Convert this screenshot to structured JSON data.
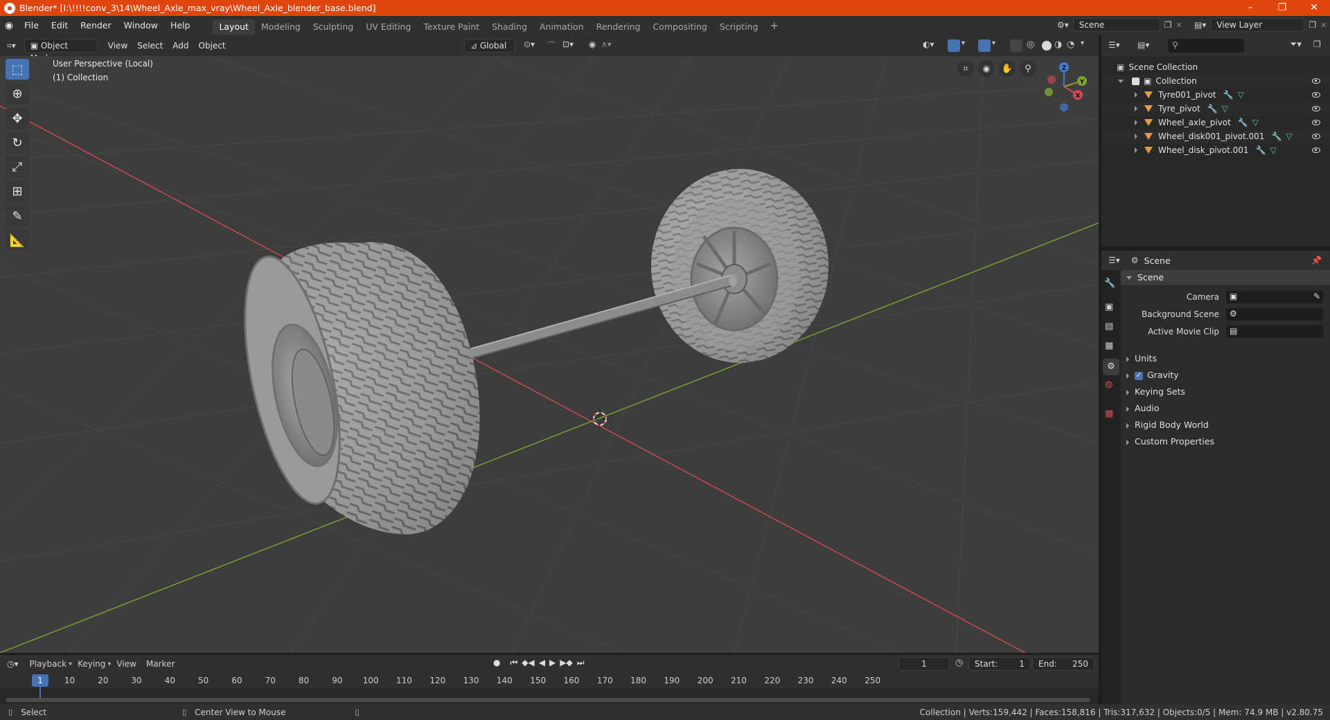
{
  "window": {
    "title": "Blender* [I:\\!!!!conv_3\\14\\Wheel_Axle_max_vray\\Wheel_Axle_blender_base.blend]",
    "controls": [
      "–",
      "❐",
      "✕"
    ]
  },
  "menu": [
    "File",
    "Edit",
    "Render",
    "Window",
    "Help"
  ],
  "workspaces": [
    "Layout",
    "Modeling",
    "Sculpting",
    "UV Editing",
    "Texture Paint",
    "Shading",
    "Animation",
    "Rendering",
    "Compositing",
    "Scripting"
  ],
  "active_workspace": "Layout",
  "scene_selector": "Scene",
  "view_layer_selector": "View Layer",
  "viewport_header": {
    "mode": "Object Mode",
    "menus": [
      "View",
      "Select",
      "Add",
      "Object"
    ],
    "orientation": "Global"
  },
  "viewport": {
    "perspective": "User Perspective (Local)",
    "collection": "(1) Collection",
    "gizmo_axes": [
      "Z",
      "Y",
      "X"
    ]
  },
  "outliner": {
    "root": "Scene Collection",
    "collection": "Collection",
    "items": [
      "Tyre001_pivot",
      "Tyre_pivot",
      "Wheel_axle_pivot",
      "Wheel_disk001_pivot.001",
      "Wheel_disk_pivot.001"
    ]
  },
  "properties": {
    "header": "Scene",
    "panel": "Scene",
    "fields": [
      {
        "label": "Camera"
      },
      {
        "label": "Background Scene"
      },
      {
        "label": "Active Movie Clip"
      }
    ],
    "subpanels": [
      "Units",
      "Gravity",
      "Keying Sets",
      "Audio",
      "Rigid Body World",
      "Custom Properties"
    ],
    "gravity_checked": true
  },
  "timeline": {
    "menus": [
      "Playback",
      "Keying",
      "View",
      "Marker"
    ],
    "current_frame": "1",
    "start_label": "Start:",
    "start": "1",
    "end_label": "End:",
    "end": "250",
    "ruler": [
      "1",
      "10",
      "20",
      "30",
      "40",
      "50",
      "60",
      "70",
      "80",
      "90",
      "100",
      "110",
      "120",
      "130",
      "140",
      "150",
      "160",
      "170",
      "180",
      "190",
      "200",
      "210",
      "220",
      "230",
      "240",
      "250"
    ]
  },
  "statusbar": {
    "left_action": "Select",
    "middle_action": "Center View to Mouse",
    "stats": "Collection | Verts:159,442 | Faces:158,816 | Tris:317,632 | Objects:0/5 | Mem: 74.9 MB | v2.80.75"
  },
  "colors": {
    "titlebar": "#e0450f",
    "accent": "#4772b3",
    "viewport_bg": "#3d3d3d",
    "x_axis": "#d34a55",
    "y_axis": "#7ea62f",
    "z_axis": "#3f7fd4"
  }
}
